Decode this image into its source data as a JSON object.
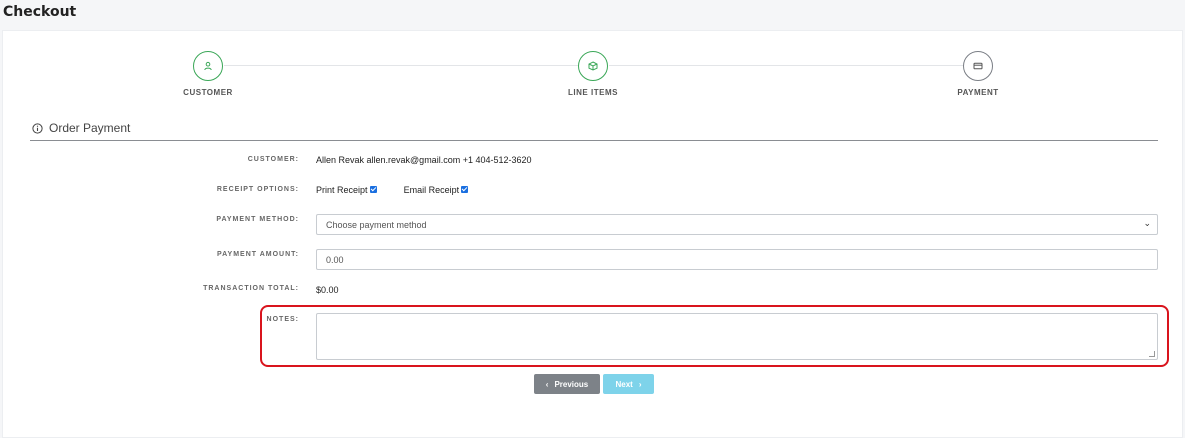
{
  "page": {
    "title": "Checkout"
  },
  "stepper": {
    "steps": [
      {
        "label": "CUSTOMER",
        "icon": "user-icon",
        "state": "complete"
      },
      {
        "label": "LINE ITEMS",
        "icon": "box-icon",
        "state": "complete"
      },
      {
        "label": "PAYMENT",
        "icon": "card-icon",
        "state": "current"
      }
    ],
    "colors": {
      "complete": "#3aa757",
      "inactive": "#7a7e85"
    }
  },
  "section": {
    "title": "Order Payment",
    "icon": "info-icon"
  },
  "form": {
    "customer_label": "CUSTOMER:",
    "customer_value": "Allen Revak allen.revak@gmail.com +1 404-512-3620",
    "receipt_label": "RECEIPT OPTIONS:",
    "print_receipt_label": "Print Receipt",
    "print_receipt_checked": true,
    "email_receipt_label": "Email Receipt",
    "email_receipt_checked": true,
    "payment_method_label": "PAYMENT METHOD:",
    "payment_method_placeholder": "Choose payment method",
    "payment_amount_label": "PAYMENT AMOUNT:",
    "payment_amount_value": "0.00",
    "transaction_total_label": "TRANSACTION TOTAL:",
    "transaction_total_value": "$0.00",
    "notes_label": "NOTES:",
    "notes_value": ""
  },
  "buttons": {
    "previous_label": "Previous",
    "next_label": "Next",
    "previous_icon": "chevron-left-icon",
    "next_icon": "chevron-right-icon"
  },
  "highlight_color": "#d9141d"
}
